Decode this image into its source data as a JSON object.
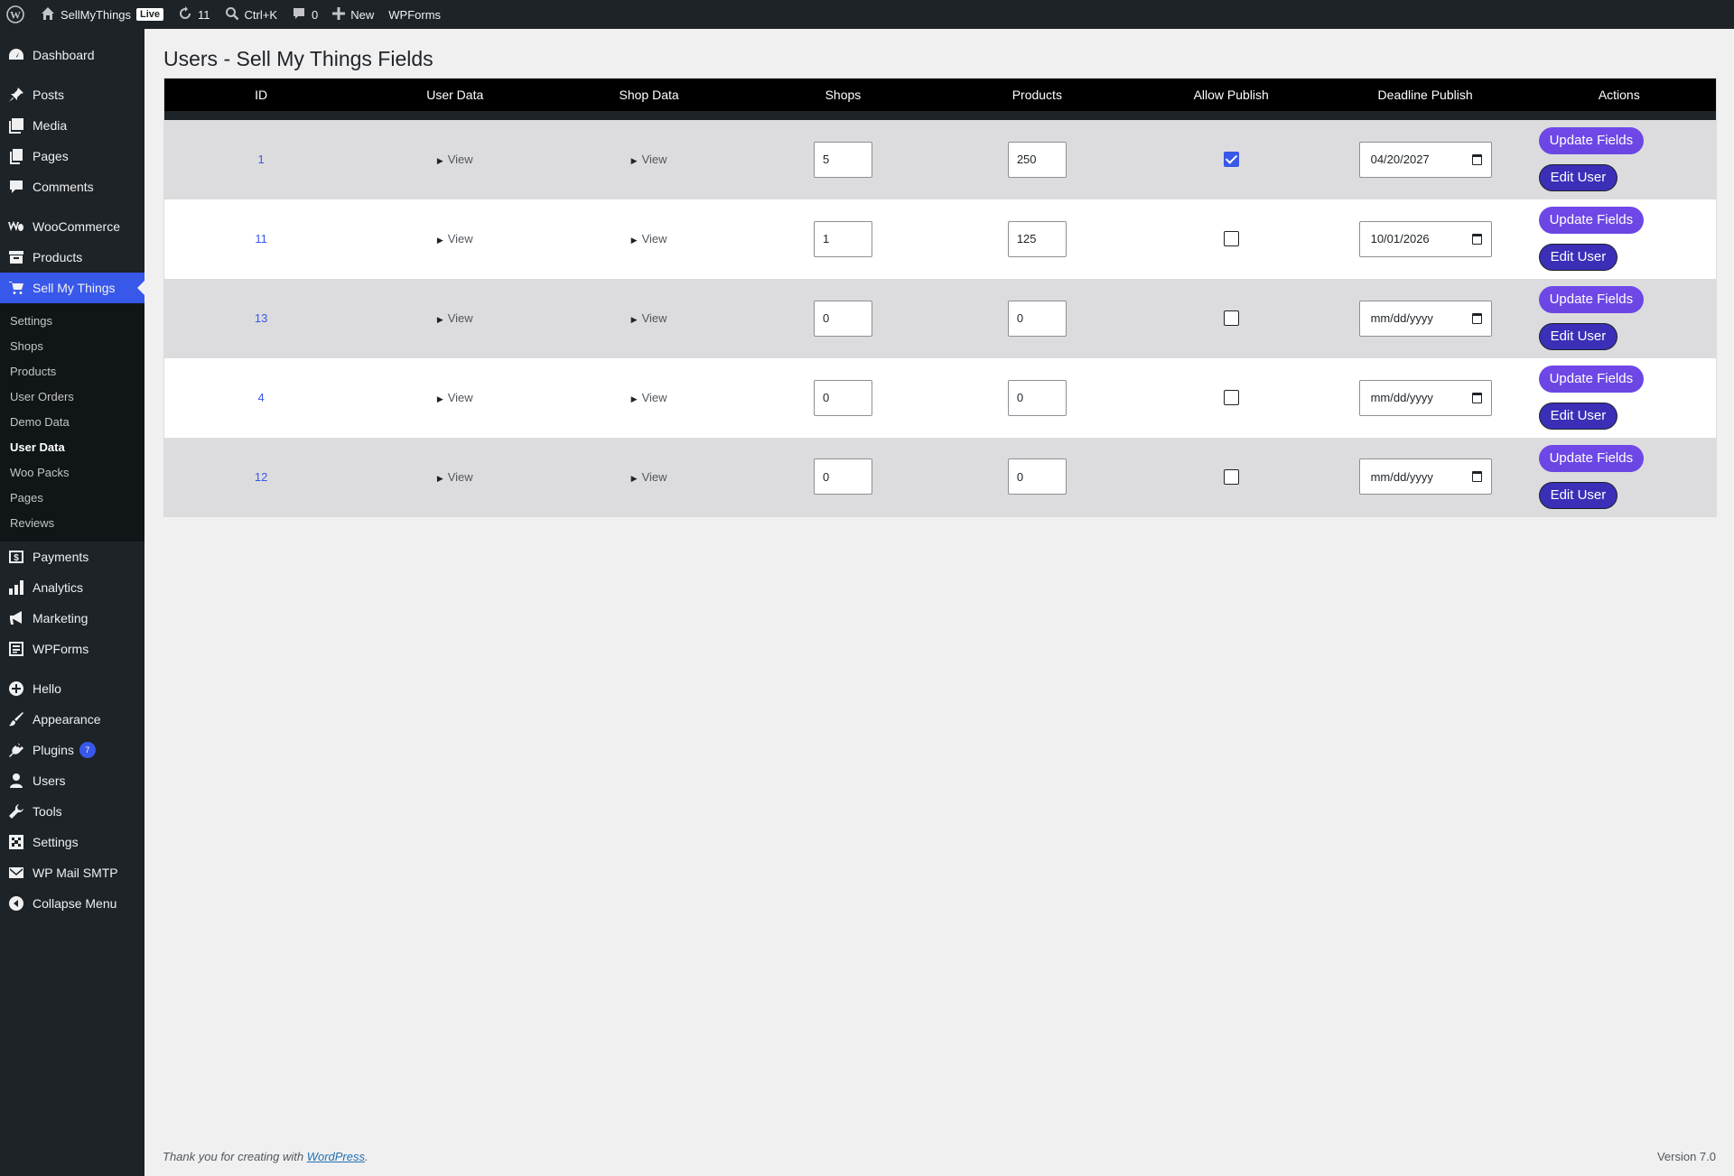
{
  "adminbar": {
    "site_name": "SellMyThings",
    "live_badge": "Live",
    "updates_count": "11",
    "search_shortcut": "Ctrl+K",
    "comments_count": "0",
    "new_label": "New",
    "wpforms_label": "WPForms"
  },
  "sidebar": {
    "dashboard": "Dashboard",
    "posts": "Posts",
    "media": "Media",
    "pages": "Pages",
    "comments": "Comments",
    "woocommerce": "WooCommerce",
    "products": "Products",
    "sellmythings": "Sell My Things",
    "submenu": [
      "Settings",
      "Shops",
      "Products",
      "User Orders",
      "Demo Data",
      "User Data",
      "Woo Packs",
      "Pages",
      "Reviews"
    ],
    "payments": "Payments",
    "analytics": "Analytics",
    "marketing": "Marketing",
    "wpforms": "WPForms",
    "hello": "Hello",
    "appearance": "Appearance",
    "plugins": "Plugins",
    "plugins_badge": "7",
    "users": "Users",
    "tools": "Tools",
    "settings": "Settings",
    "wpmailsmtp": "WP Mail SMTP",
    "collapse": "Collapse Menu"
  },
  "page": {
    "title": "Users - Sell My Things Fields"
  },
  "table": {
    "headers": [
      "ID",
      "User Data",
      "Shop Data",
      "Shops",
      "Products",
      "Allow Publish",
      "Deadline Publish",
      "Actions"
    ],
    "view_label": "View",
    "update_label": "Update Fields",
    "edit_label": "Edit User",
    "rows": [
      {
        "id": "1",
        "shops": "5",
        "products": "250",
        "allow": true,
        "deadline": "04/20/2027"
      },
      {
        "id": "11",
        "shops": "1",
        "products": "125",
        "allow": false,
        "deadline": "10/01/2026"
      },
      {
        "id": "13",
        "shops": "0",
        "products": "0",
        "allow": false,
        "deadline": "mm/dd/yyyy"
      },
      {
        "id": "4",
        "shops": "0",
        "products": "0",
        "allow": false,
        "deadline": "mm/dd/yyyy"
      },
      {
        "id": "12",
        "shops": "0",
        "products": "0",
        "allow": false,
        "deadline": "mm/dd/yyyy"
      }
    ]
  },
  "footer": {
    "thanks_prefix": "Thank you for creating with ",
    "wp_link": "WordPress",
    "thanks_suffix": ".",
    "version": "Version 7.0"
  },
  "colors": {
    "accent": "#3858e9",
    "button_update": "#6a48e6",
    "button_edit": "#3b2fb8",
    "sidebar_bg": "#1d2327"
  }
}
